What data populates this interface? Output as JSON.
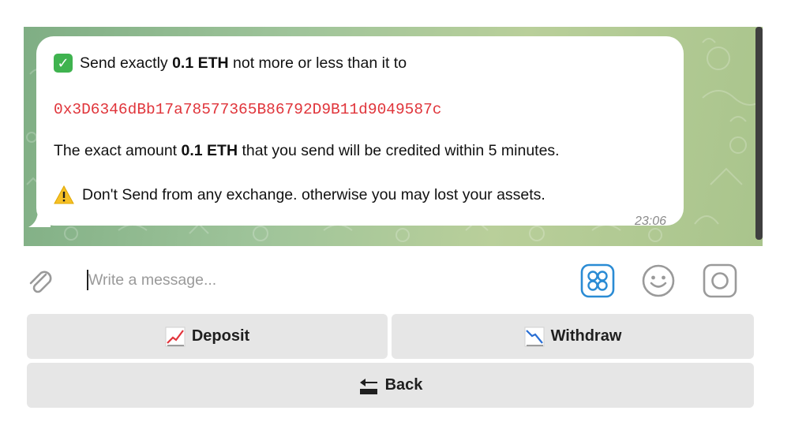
{
  "message": {
    "line1": {
      "prefix": "Send exactly ",
      "amount": "0.1 ETH",
      "suffix": " not more or less than it to"
    },
    "address": "0x3D6346dBb17a78577365B86792D9B11d9049587c",
    "line3": {
      "prefix": "The exact amount ",
      "amount": "0.1 ETH",
      "suffix": " that you send will be credited within 5 minutes."
    },
    "line4": "Don't Send from any exchange. otherwise you may lost your assets.",
    "time": "23:06",
    "icons": {
      "line1": "check-mark-icon",
      "line4": "warning-icon"
    }
  },
  "composer": {
    "placeholder": "Write a message...",
    "icons": [
      "paperclip-icon",
      "bot-commands-icon",
      "emoji-icon",
      "camera-icon"
    ]
  },
  "keyboard": {
    "rows": [
      [
        {
          "label": "Deposit",
          "icon": "chart-up-icon"
        },
        {
          "label": "Withdraw",
          "icon": "chart-down-icon"
        }
      ],
      [
        {
          "label": "Back",
          "icon": "back-arrow-icon"
        }
      ]
    ]
  },
  "colors": {
    "address": "#e0353b",
    "accent": "#2a8bd4",
    "wallpaper": "#9fc49a",
    "button_bg": "#e6e6e6"
  }
}
